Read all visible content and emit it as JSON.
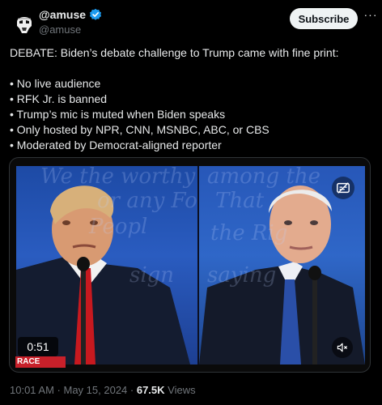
{
  "author": {
    "display_name": "@amuse",
    "handle": "@amuse",
    "verified": true,
    "avatar_icon": "stormtrooper-avatar"
  },
  "actions": {
    "subscribe_label": "Subscribe",
    "more_label": "···"
  },
  "tweet": {
    "headline": "DEBATE: Biden’s debate challenge to Trump came with fine print:",
    "bullets": [
      "• No live audience",
      "• RFK Jr. is banned",
      "• Trump’s mic is muted when Biden speaks",
      "• Only hosted by NPR, CNN, MSNBC, ABC, or CBS",
      "• Moderated by Democrat-aligned reporter"
    ]
  },
  "media": {
    "type": "video",
    "duration": "0:51",
    "banner_text": "RACE",
    "mute_icon": "speaker-muted-icon",
    "caption_icon": "captions-icon"
  },
  "meta": {
    "time": "10:01 AM",
    "sep1": " · ",
    "date": "May 15, 2024",
    "sep2": " · ",
    "views_count": "67.5K",
    "views_label": " Views"
  },
  "colors": {
    "background": "#000000",
    "text": "#e7e9ea",
    "secondary": "#71767b",
    "verified": "#1d9bf0",
    "subscribe_bg": "#eff3f4"
  }
}
